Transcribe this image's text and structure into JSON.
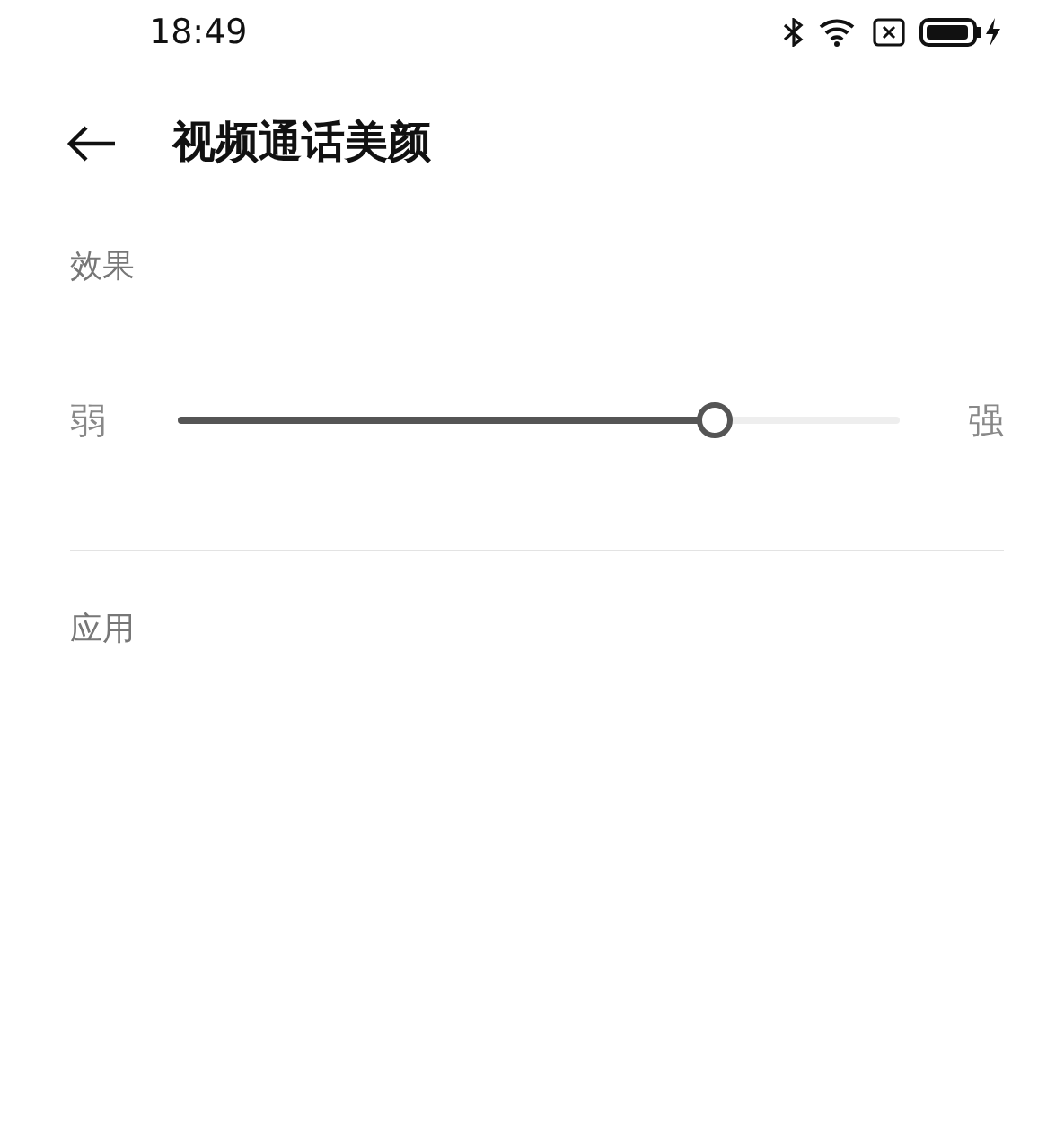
{
  "status_bar": {
    "time": "18:49"
  },
  "header": {
    "title": "视频通话美颜"
  },
  "sections": [
    {
      "title": "效果",
      "slider": {
        "min_label": "弱",
        "max_label": "强",
        "level": 0.745
      }
    },
    {
      "title": "应用"
    }
  ]
}
